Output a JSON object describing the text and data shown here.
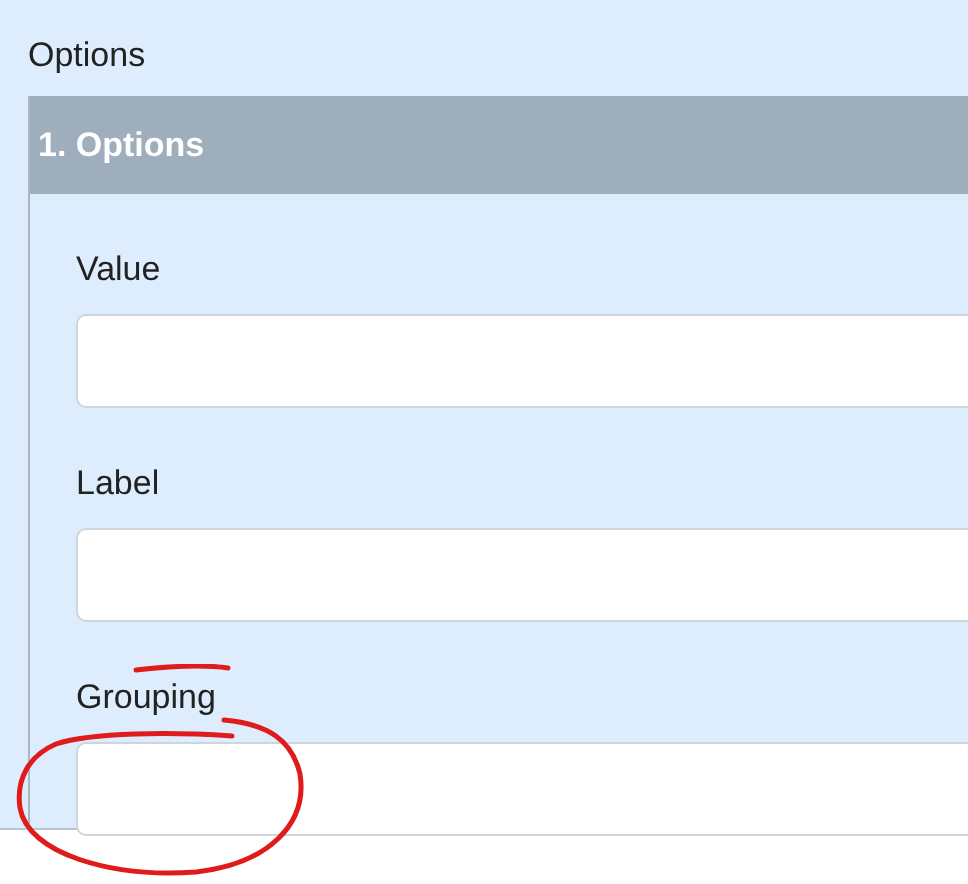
{
  "section_label": "Options",
  "panel": {
    "title": "1. Options",
    "fields": [
      {
        "label": "Value"
      },
      {
        "label": "Label"
      },
      {
        "label": "Grouping"
      }
    ]
  }
}
